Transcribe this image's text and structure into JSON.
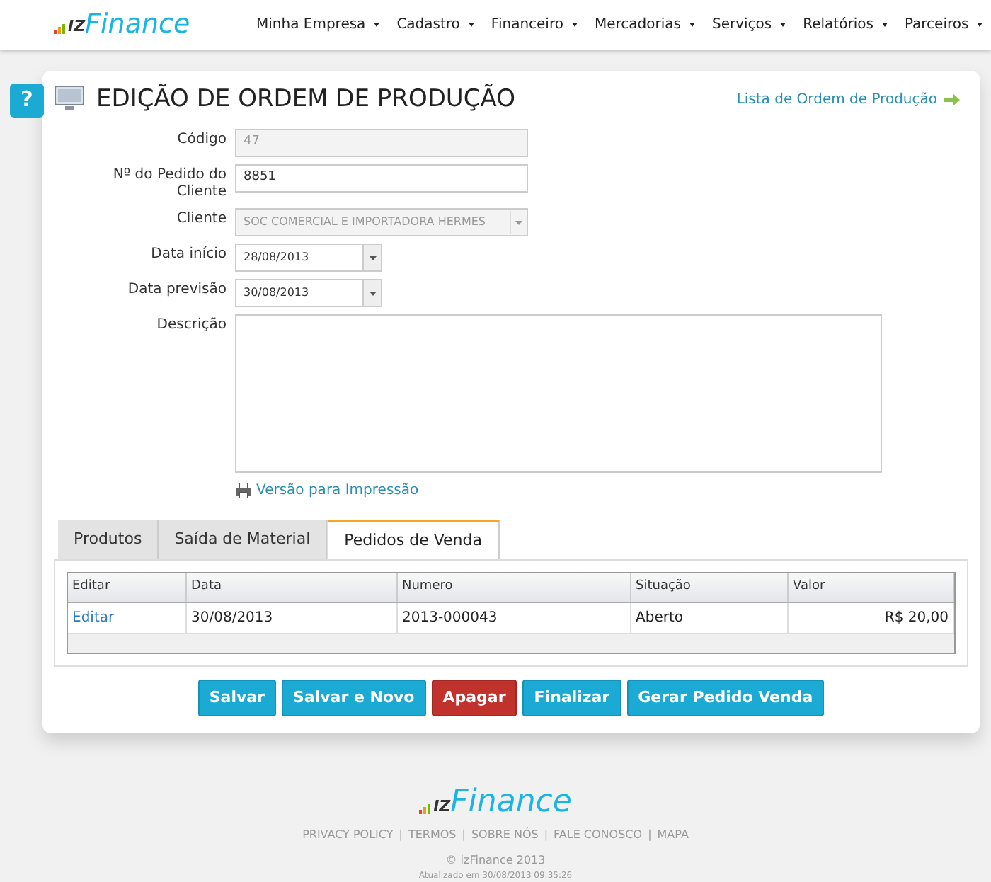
{
  "logo": {
    "prefix": "IZ",
    "name": "Finance"
  },
  "nav": [
    "Minha Empresa",
    "Cadastro",
    "Financeiro",
    "Mercadorias",
    "Serviços",
    "Relatórios",
    "Parceiros"
  ],
  "help": "?",
  "page": {
    "title": "EDIÇÃO DE ORDEM DE PRODUÇÃO",
    "back_link": "Lista de Ordem de Produção"
  },
  "fields": [
    {
      "label": "Código",
      "kind": "text",
      "value": "47",
      "disabled": true
    },
    {
      "label": "Nº do Pedido do Cliente",
      "kind": "text",
      "value": "8851",
      "disabled": false
    },
    {
      "label": "Cliente",
      "kind": "select",
      "value": "SOC COMERCIAL E IMPORTADORA HERMES",
      "disabled": true
    },
    {
      "label": "Data início",
      "kind": "date",
      "value": "28/08/2013",
      "disabled": false
    },
    {
      "label": "Data previsão",
      "kind": "date",
      "value": "30/08/2013",
      "disabled": false
    },
    {
      "label": "Descrição",
      "kind": "textarea",
      "disabled": false
    }
  ],
  "print_link": "Versão para Impressão",
  "tabs": [
    {
      "label": "Produtos",
      "selected": false
    },
    {
      "label": "Saída de Material",
      "selected": false
    },
    {
      "label": "Pedidos de Venda",
      "selected": true
    }
  ],
  "table": {
    "columns": [
      "Editar",
      "Data",
      "Numero",
      "Situação",
      "Valor"
    ],
    "rows": [
      [
        "Editar",
        "30/08/2013",
        "2013-000043",
        "Aberto",
        "R$ 20,00"
      ]
    ]
  },
  "buttons": [
    {
      "label": "Salvar",
      "kind": "primary"
    },
    {
      "label": "Salvar e Novo",
      "kind": "primary"
    },
    {
      "label": "Apagar",
      "kind": "danger"
    },
    {
      "label": "Finalizar",
      "kind": "primary"
    },
    {
      "label": "Gerar Pedido Venda",
      "kind": "primary"
    }
  ],
  "footer": {
    "logo": {
      "prefix": "IZ",
      "name": "Finance"
    },
    "links": [
      "PRIVACY POLICY",
      "TERMOS",
      "SOBRE NÓS",
      "FALE CONOSCO",
      "MAPA"
    ],
    "separator": "|",
    "copyright": "© izFinance 2013",
    "updated": "Atualizado em 30/08/2013 09:35:26"
  }
}
